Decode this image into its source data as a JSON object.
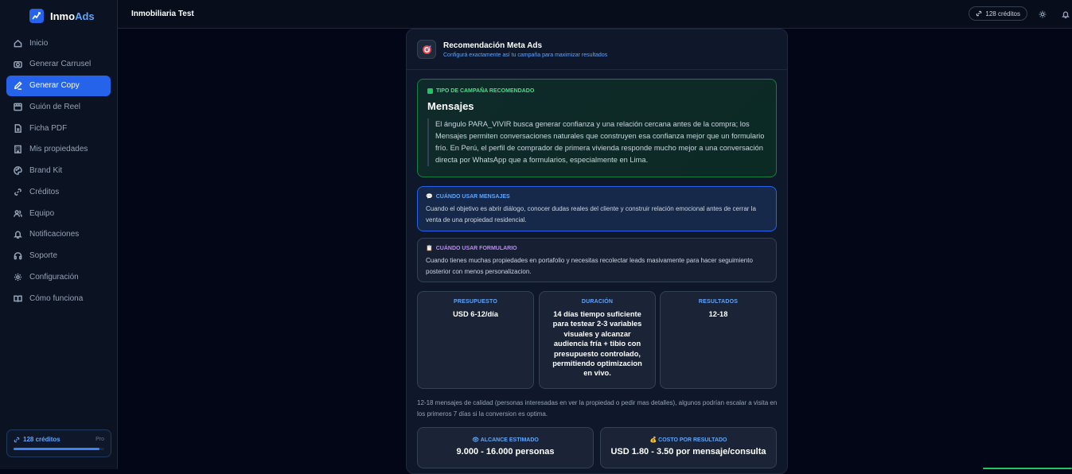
{
  "app": {
    "name_main": "Inmo",
    "name_accent": "Ads"
  },
  "sidebar": {
    "items": [
      {
        "label": "Inicio",
        "icon": "home-icon"
      },
      {
        "label": "Generar Carrusel",
        "icon": "camera-icon"
      },
      {
        "label": "Generar Copy",
        "icon": "pen-icon",
        "active": true
      },
      {
        "label": "Guión de Reel",
        "icon": "film-icon"
      },
      {
        "label": "Ficha PDF",
        "icon": "file-icon"
      },
      {
        "label": "Mis propiedades",
        "icon": "building-icon"
      },
      {
        "label": "Brand Kit",
        "icon": "palette-icon"
      },
      {
        "label": "Créditos",
        "icon": "link-icon"
      },
      {
        "label": "Equipo",
        "icon": "users-icon"
      },
      {
        "label": "Notificaciones",
        "icon": "bell-icon"
      },
      {
        "label": "Soporte",
        "icon": "headphones-icon"
      },
      {
        "label": "Configuración",
        "icon": "gear-icon"
      },
      {
        "label": "Cómo funciona",
        "icon": "book-icon"
      }
    ],
    "credits": {
      "label": "128 créditos",
      "plan": "Pro",
      "progress": 0.95
    }
  },
  "header": {
    "title": "Inmobiliaria Test",
    "credits": "128 créditos"
  },
  "card": {
    "title": "Recomendación Meta Ads",
    "subtitle": "Configurá exactamente así tu campaña para maximizar resultados",
    "campaign": {
      "tag": "TIPO DE CAMPAÑA RECOMENDADO",
      "title": "Mensajes",
      "text": "El ángulo PARA_VIVIR busca generar confianza y una relación cercana antes de la compra; los Mensajes permiten conversaciones naturales que construyen esa confianza mejor que un formulario frío. En Perú, el perfil de comprador de primera vivienda responde mucho mejor a una conversación directa por WhatsApp que a formularios, especialmente en Lima."
    },
    "when_messages": {
      "tag": "CUÁNDO USAR MENSAJES",
      "text": "Cuando el objetivo es abrir diálogo, conocer dudas reales del cliente y construir relación emocional antes de cerrar la venta de una propiedad residencial."
    },
    "when_form": {
      "tag": "CUÁNDO USAR FORMULARIO",
      "text": "Cuando tienes muchas propiedades en portafolio y necesitas recolectar leads masivamente para hacer seguimiento posterior con menos personalizacion."
    },
    "stats": [
      {
        "label": "PRESUPUESTO",
        "value": "USD 6-12/día"
      },
      {
        "label": "DURACIÓN",
        "value": "14 días tiempo suficiente para testear 2-3 variables visuales y alcanzar audiencia fría + tibio con presupuesto controlado, permitiendo optimizacion en vivo."
      },
      {
        "label": "RESULTADOS",
        "value": "12-18"
      }
    ],
    "results_note": "12-18 mensajes de calidad (personas interesadas en ver la propiedad o pedir mas detalles), algunos podrían escalar a visita en los primeros 7 días si la conversion es optima.",
    "metrics": [
      {
        "label": "ALCANCE ESTIMADO",
        "value": "9.000 - 16.000 personas",
        "icon": "eye-icon"
      },
      {
        "label": "COSTO POR RESULTADO",
        "value": "USD 1.80 - 3.50 por mensaje/consulta",
        "icon": "money-bag-icon"
      }
    ]
  },
  "colors": {
    "accent": "#2563eb",
    "success": "#22c55e",
    "background": "#020617"
  }
}
